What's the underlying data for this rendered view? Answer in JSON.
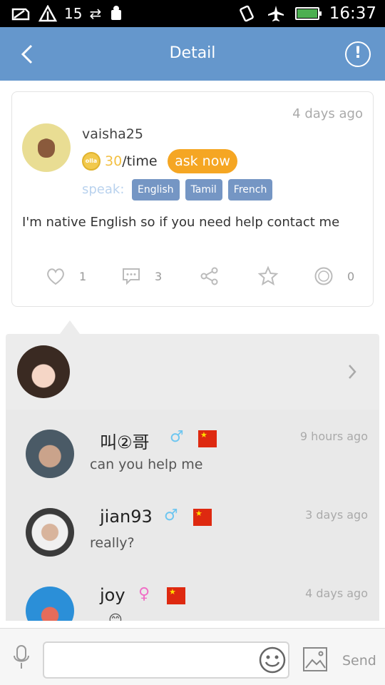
{
  "status_bar": {
    "signal_count": "15",
    "time": "16:37",
    "icons": [
      "signal-icon",
      "wifi-icon",
      "data-transfer-icon",
      "android-debug-icon",
      "vibrate-icon",
      "airplane-icon",
      "battery-icon"
    ]
  },
  "header": {
    "title": "Detail",
    "back_icon": "back-arrow-icon",
    "info_icon": "info-icon"
  },
  "post": {
    "time": "4 days ago",
    "username": "vaisha25",
    "coin_label": "olla",
    "price_amount": "30",
    "price_unit": "/time",
    "ask_label": "ask now",
    "speak_label": "speak:",
    "languages": [
      "English",
      "Tamil",
      "French"
    ],
    "body": "I'm native English so if you need help contact me",
    "likes": "1",
    "comments_count": "3",
    "olla_count": "0"
  },
  "comments": [
    {
      "name": "叫②哥",
      "gender": "♂",
      "gender_color": "#6ec6f0",
      "time": "9 hours ago",
      "text": "can you help me"
    },
    {
      "name": "jian93",
      "gender": "♂",
      "gender_color": "#6ec6f0",
      "time": "3 days ago",
      "text": "really?"
    },
    {
      "name": "joy",
      "gender": "♀",
      "gender_color": "#f06ec6",
      "time": "4 days ago",
      "text": "😊"
    }
  ],
  "input_bar": {
    "placeholder": "",
    "send_label": "Send"
  },
  "colors": {
    "header_bg": "#6597cc",
    "ask_button": "#f5a623",
    "language_tag": "#7596c4",
    "coin": "#f3c043"
  }
}
